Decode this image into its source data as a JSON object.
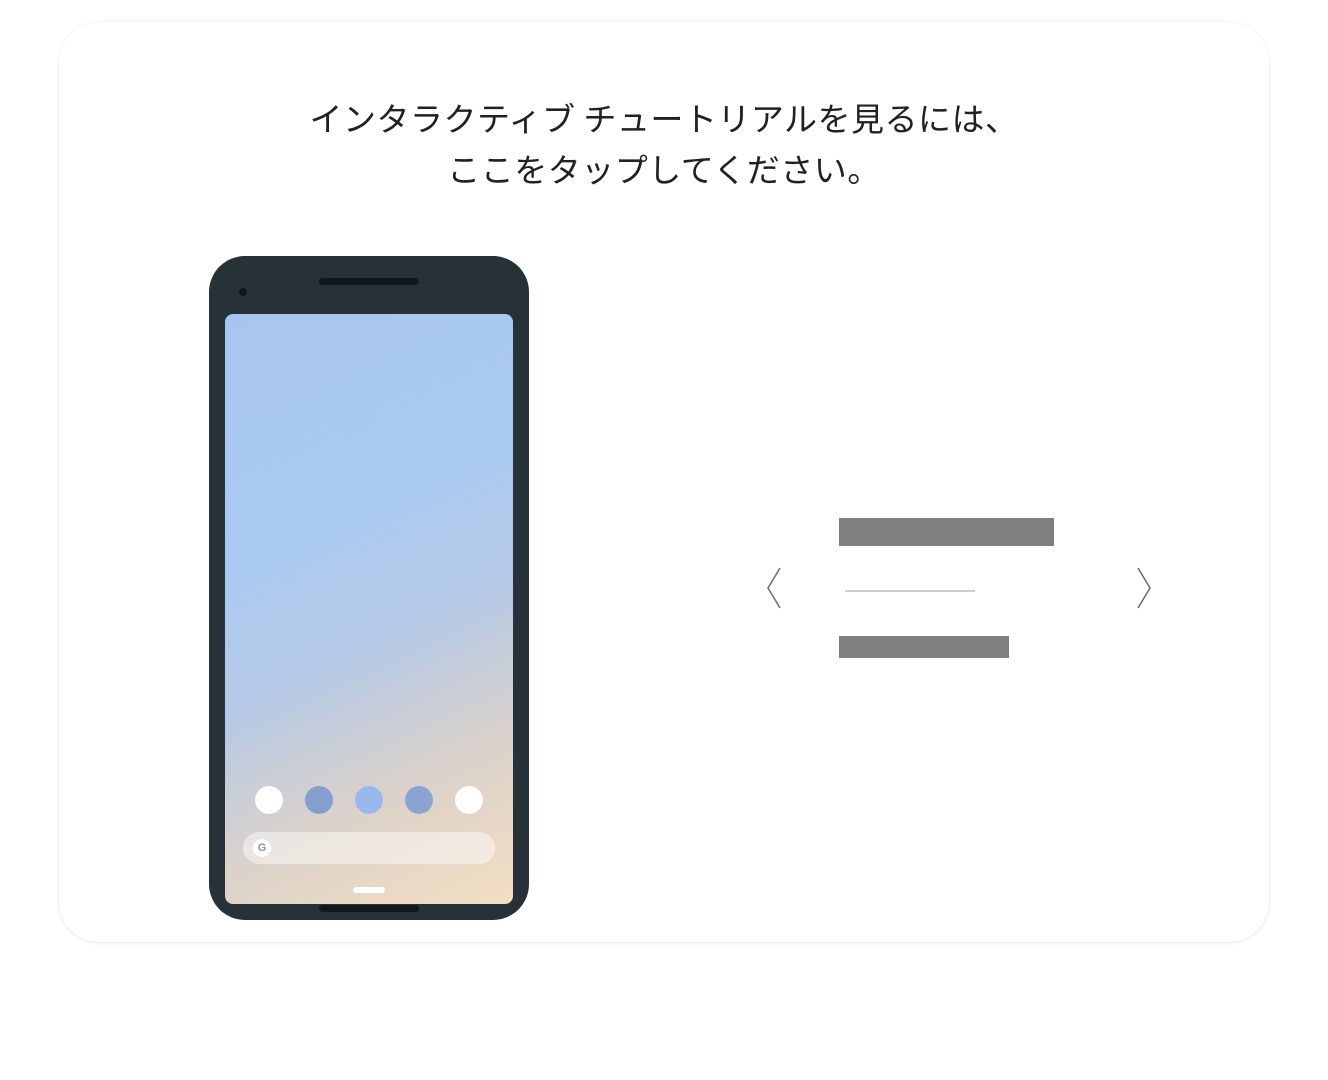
{
  "heading": {
    "line1": "インタラクティブ チュートリアルを見るには、",
    "line2": "ここをタップしてください。"
  },
  "search": {
    "letter": "G"
  }
}
